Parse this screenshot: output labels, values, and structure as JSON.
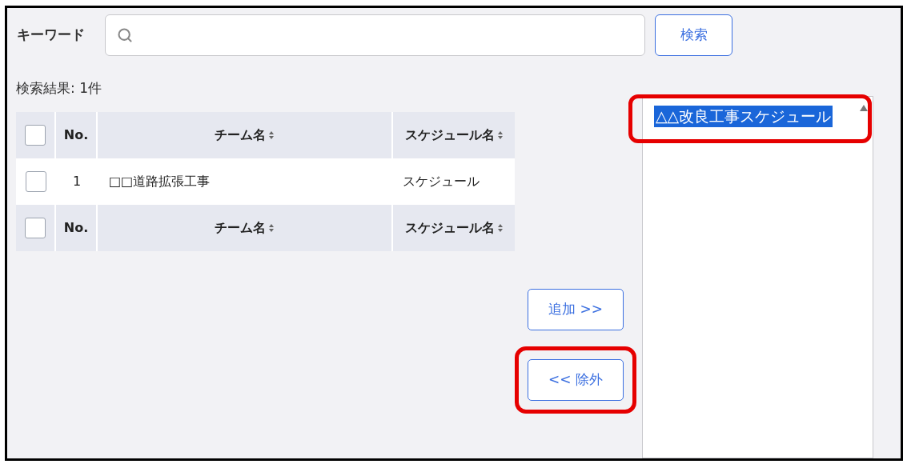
{
  "search": {
    "label": "キーワード",
    "button": "検索"
  },
  "result_count": "検索結果: 1件",
  "table": {
    "select_all_top": {
      "checked": false
    },
    "select_all_bottom": {
      "checked": false
    },
    "columns": [
      {
        "label": "No.",
        "sortable": false
      },
      {
        "label": "チーム名",
        "sortable": true
      },
      {
        "label": "スケジュール名",
        "sortable": true
      }
    ],
    "footer_columns": [
      {
        "label": "No.",
        "sortable": false
      },
      {
        "label": "チーム名",
        "sortable": true
      },
      {
        "label": "スケジュール名",
        "sortable": true
      }
    ],
    "rows": [
      {
        "checked": false,
        "no": "1",
        "team": "□□道路拡張工事",
        "schedule": "スケジュール"
      }
    ]
  },
  "actions": [
    {
      "label": "追加 >>",
      "highlighted": false
    },
    {
      "label": "<< 除外",
      "highlighted": true
    }
  ],
  "selected_list": {
    "highlighted": true,
    "items": [
      {
        "label": "△△改良工事スケジュール",
        "selected": true
      }
    ]
  }
}
